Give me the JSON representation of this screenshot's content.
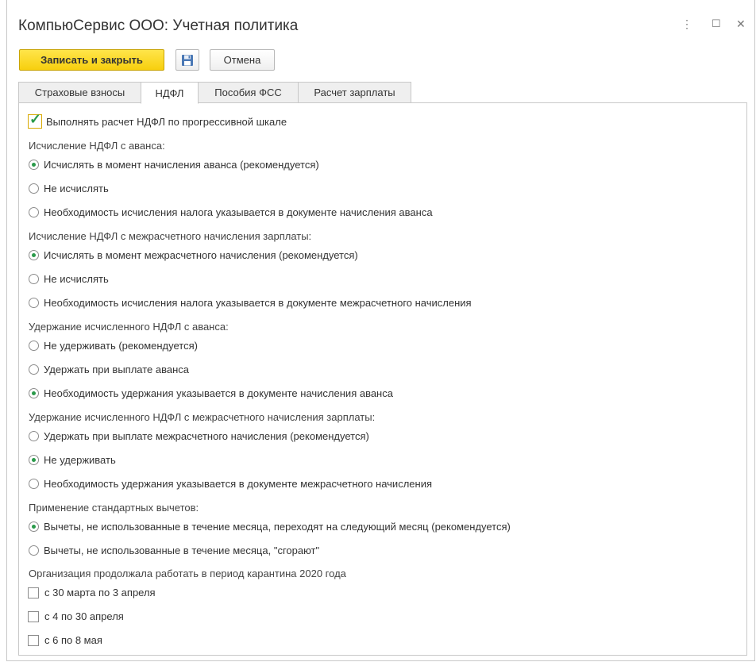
{
  "window": {
    "title": "КомпьюСервис ООО: Учетная политика",
    "controls": {
      "menu": "⋮",
      "maximize": "☐",
      "close": "✕"
    }
  },
  "toolbar": {
    "save_close_label": "Записать и закрыть",
    "save_icon": "floppy-disk-icon",
    "cancel_label": "Отмена"
  },
  "tabs": [
    {
      "label": "Страховые взносы",
      "active": false
    },
    {
      "label": "НДФЛ",
      "active": true
    },
    {
      "label": "Пособия ФСС",
      "active": false
    },
    {
      "label": "Расчет зарплаты",
      "active": false
    }
  ],
  "progressive": {
    "label": "Выполнять расчет НДФЛ по прогрессивной шкале",
    "checked": true
  },
  "groups": [
    {
      "label": "Исчисление НДФЛ с аванса:",
      "options": [
        {
          "label": "Исчислять в момент начисления аванса (рекомендуется)",
          "selected": true
        },
        {
          "label": "Не исчислять",
          "selected": false
        },
        {
          "label": "Необходимость исчисления налога указывается в документе начисления аванса",
          "selected": false
        }
      ]
    },
    {
      "label": "Исчисление НДФЛ с межрасчетного начисления зарплаты:",
      "options": [
        {
          "label": "Исчислять в момент межрасчетного начисления (рекомендуется)",
          "selected": true
        },
        {
          "label": "Не исчислять",
          "selected": false
        },
        {
          "label": "Необходимость исчисления налога указывается в документе межрасчетного начисления",
          "selected": false
        }
      ]
    },
    {
      "label": "Удержание исчисленного НДФЛ с аванса:",
      "options": [
        {
          "label": "Не удерживать (рекомендуется)",
          "selected": false
        },
        {
          "label": "Удержать при выплате аванса",
          "selected": false
        },
        {
          "label": "Необходимость удержания указывается в документе начисления аванса",
          "selected": true
        }
      ]
    },
    {
      "label": "Удержание исчисленного НДФЛ с межрасчетного начисления зарплаты:",
      "options": [
        {
          "label": "Удержать при выплате межрасчетного начисления (рекомендуется)",
          "selected": false
        },
        {
          "label": "Не удерживать",
          "selected": true
        },
        {
          "label": "Необходимость удержания указывается в документе межрасчетного начисления",
          "selected": false
        }
      ]
    },
    {
      "label": "Применение стандартных вычетов:",
      "options": [
        {
          "label": "Вычеты, не использованные в течение месяца, переходят на следующий месяц (рекомендуется)",
          "selected": true
        },
        {
          "label": "Вычеты, не использованные в течение месяца, \"сгорают\"",
          "selected": false
        }
      ]
    }
  ],
  "quarantine": {
    "label": "Организация продолжала работать в период карантина 2020 года",
    "options": [
      {
        "label": "с 30 марта по 3 апреля",
        "checked": false
      },
      {
        "label": "с 4 по 30 апреля",
        "checked": false
      },
      {
        "label": "с 6 по 8 мая",
        "checked": false
      }
    ]
  }
}
